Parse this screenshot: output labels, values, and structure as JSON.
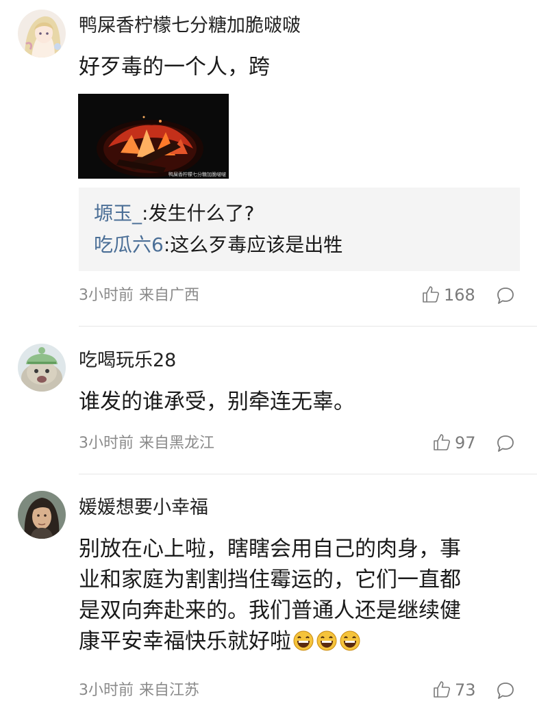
{
  "comments": [
    {
      "username": "鸭屎香柠檬七分糖加脆啵啵",
      "text": "好歹毒的一个人，跨",
      "image_caption": "鸭屎香柠檬七分糖加脆啵啵",
      "replies": [
        {
          "user": "塬玉_",
          "text": ":发生什么了?"
        },
        {
          "user": "吃瓜六6",
          "text": ":这么歹毒应该是出牲"
        }
      ],
      "time": "3小时前",
      "location": "来自广西",
      "likes": "168"
    },
    {
      "username": "吃喝玩乐28",
      "text": "谁发的谁承受，别牵连无辜。",
      "time": "3小时前",
      "location": "来自黑龙江",
      "likes": "97"
    },
    {
      "username": "媛媛想要小幸福",
      "text_lines": [
        "别放在心上啦，瞎瞎会用自己的肉身，事",
        "业和家庭为割割挡住霉运的，它们一直都",
        "是双向奔赴来的。我们普通人还是继续健",
        "康平安幸福快乐就好啦"
      ],
      "emoji": [
        "grin-emoji",
        "grin-emoji",
        "grin-emoji"
      ],
      "time": "3小时前",
      "location": "来自江苏",
      "likes": "73"
    }
  ],
  "colors": {
    "reply_user": "#4a6e96",
    "meta": "#8a8a8a",
    "reply_bg": "#f4f4f4"
  }
}
